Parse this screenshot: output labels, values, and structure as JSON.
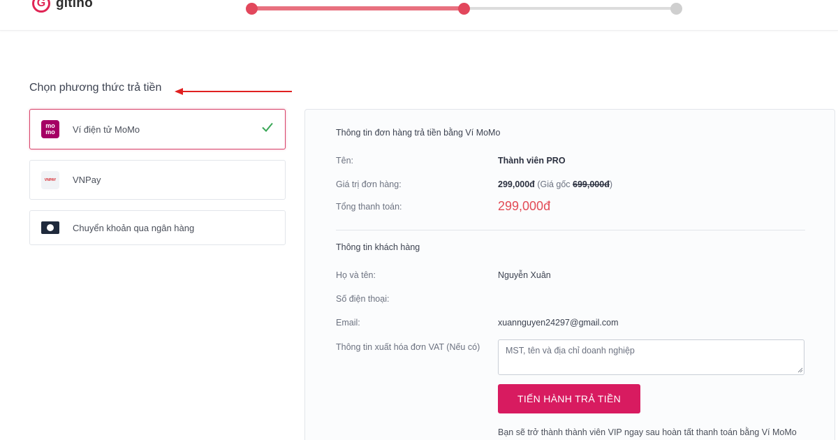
{
  "brand": {
    "logo_letter": "G",
    "name": "gitiho"
  },
  "stepper": {
    "progress": 0.5,
    "steps_total": 3,
    "current_step": 2
  },
  "payment_methods": {
    "title": "Chọn phương thức trả tiền",
    "items": [
      {
        "label": "Ví điện tử MoMo",
        "icon": "momo-icon",
        "selected": true,
        "icon_text": [
          "mo",
          "mo"
        ]
      },
      {
        "label": "VNPay",
        "icon": "vnpay-icon",
        "selected": false,
        "icon_text": "VNPAY"
      },
      {
        "label": "Chuyển khoản qua ngân hàng",
        "icon": "bank-icon",
        "selected": false
      }
    ]
  },
  "order": {
    "heading": "Thông tin đơn hàng trả tiền bằng Ví MoMo",
    "name_label": "Tên:",
    "name_value": "Thành viên PRO",
    "price_label": "Giá trị đơn hàng:",
    "price_value": "299,000đ",
    "original_prefix": "(Giá gốc ",
    "original_value": "699,000đ",
    "original_suffix": ")",
    "total_label": "Tổng thanh toán:",
    "total_value": "299,000đ"
  },
  "customer": {
    "heading": "Thông tin khách hàng",
    "fullname_label": "Họ và tên:",
    "fullname_value": "Nguyễn Xuân",
    "phone_label": "Số điện thoại:",
    "email_label": "Email:",
    "email_value": "xuannguyen24297@gmail.com",
    "vat_label": "Thông tin xuất hóa đơn VAT (Nếu có)",
    "vat_placeholder": "MST, tên và địa chỉ doanh nghiệp"
  },
  "action": {
    "pay_label": "TIẾN HÀNH TRẢ TIỀN",
    "note": "Bạn sẽ trở thành thành viên VIP ngay sau hoàn tất thanh toán bằng Ví MoMo"
  },
  "colors": {
    "accent": "#d81b60",
    "selected_border": "#d8436a",
    "total_red": "#e24a55",
    "check_green": "#3aa757",
    "annotation_red": "#e02020"
  }
}
